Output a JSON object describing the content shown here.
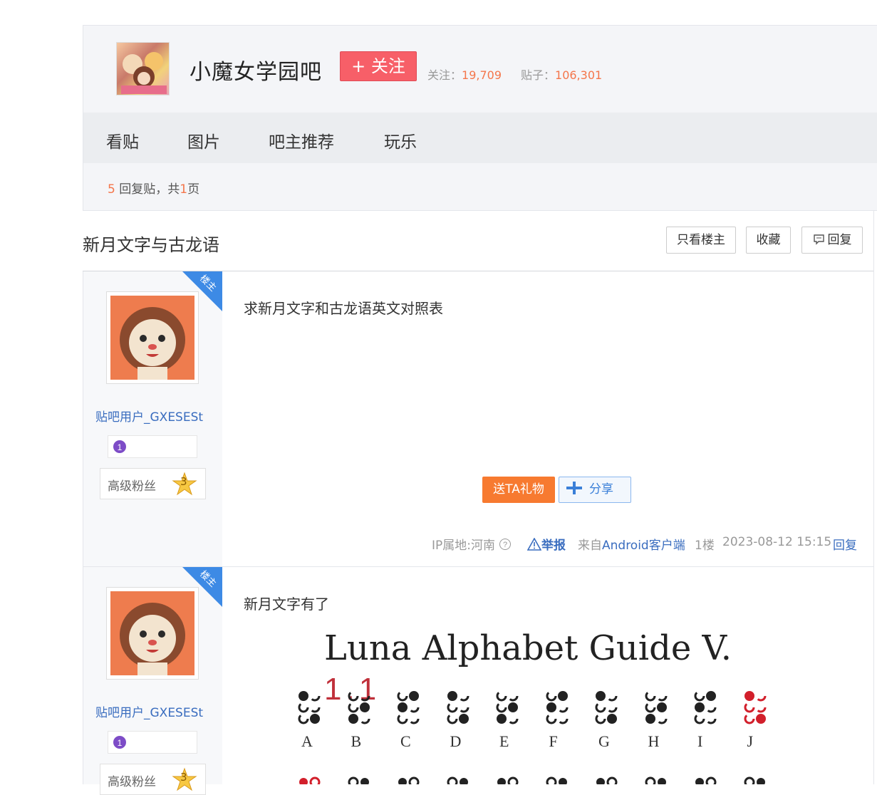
{
  "forum": {
    "name": "小魔女学园吧",
    "follow_label": "+ 关注",
    "followers_label": "关注：",
    "followers": "19,709",
    "posts_label": "贴子：",
    "posts": "106,301"
  },
  "nav": {
    "items": [
      "看贴",
      "图片",
      "吧主推荐",
      "玩乐"
    ]
  },
  "reply_bar": {
    "count": "5",
    "text1": " 回复贴，共",
    "pages": "1",
    "text2": "页"
  },
  "thread": {
    "title": "新月文字与古龙语",
    "buttons": {
      "only_op": "只看楼主",
      "favorite": "收藏",
      "reply": "回复"
    }
  },
  "posts": [
    {
      "badge": "楼主",
      "username": "贴吧用户_GXESESt",
      "fan_level_label": "高级粉丝",
      "fan_level": "3",
      "content": "求新月文字和古龙语英文对照表",
      "gift_label": "送TA礼物",
      "share_label": "分享",
      "ip": "IP属地:河南",
      "report": "举报",
      "from_prefix": "来自",
      "from_client": "Android客户端",
      "floor": "1楼",
      "time": "2023-08-12 15:15",
      "reply": "回复"
    },
    {
      "badge": "楼主",
      "username": "贴吧用户_GXESESt",
      "fan_level_label": "高级粉丝",
      "fan_level": "3",
      "content": "新月文字有了",
      "image": {
        "title": "Luna Alphabet Guide V.",
        "version": "1.1",
        "letters": [
          "A",
          "B",
          "C",
          "D",
          "E",
          "F",
          "G",
          "H",
          "I",
          "J"
        ]
      }
    }
  ],
  "colors": {
    "accent_orange": "#f4764b",
    "follow_red": "#f75f68",
    "link_blue": "#3a6dbf",
    "op_badge_blue": "#3d8ae5"
  }
}
